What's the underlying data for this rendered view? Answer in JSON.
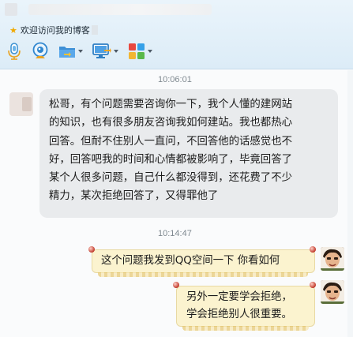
{
  "header": {
    "signature": "欢迎访问我的博客",
    "toolbar": [
      {
        "icon": "microphone-icon"
      },
      {
        "icon": "webcam-icon"
      },
      {
        "icon": "folder-transfer-icon"
      },
      {
        "icon": "screen-share-icon"
      },
      {
        "icon": "apps-grid-icon"
      }
    ]
  },
  "messages": {
    "time_1": "10:06:01",
    "incoming_lines": [
      "松哥，有个问题需要咨询你一下，我个人懂的建网站",
      "的知识，也有很多朋友咨询我如何建站。我也都热心",
      "回答。但耐不住别人一直问，不回答他的话感觉也不",
      "好，回答吧我的时间和心情都被影响了，毕竟回答了",
      "某个人很多问题，自己什么都没得到，还花费了不少",
      "精力，某次拒绝回答了，又得罪他了"
    ],
    "time_2": "10:14:47",
    "outgoing_1": "这个问题我发到QQ空间一下  你看如何",
    "outgoing_2_lines": [
      "另外一定要学会拒绝，",
      "学会拒绝别人很重要。"
    ]
  },
  "colors": {
    "header_bg": "#dcecf7",
    "incoming_bubble": "#e9ebed",
    "outgoing_bubble": "#fbf3cf"
  }
}
